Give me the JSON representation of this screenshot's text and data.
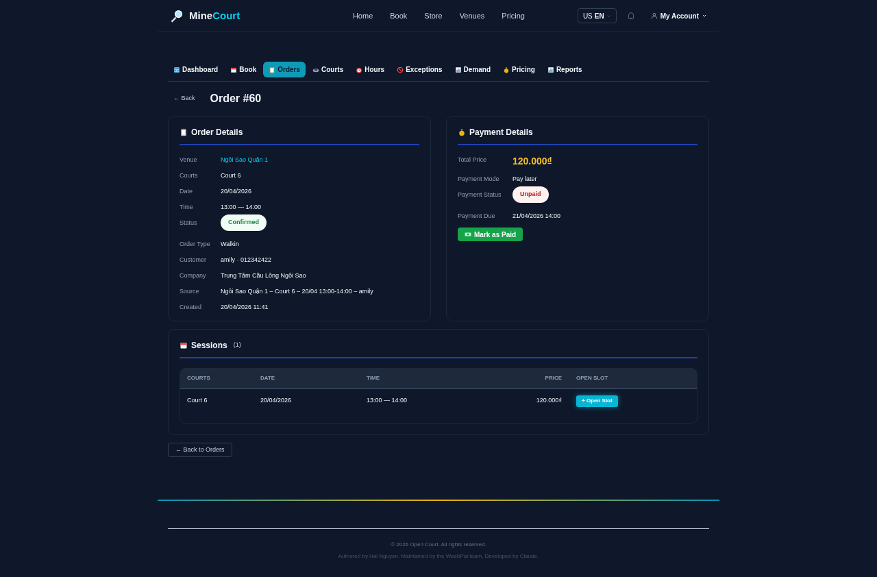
{
  "brand": {
    "first": "Mine",
    "second": "Court"
  },
  "nav": [
    "Home",
    "Book",
    "Store",
    "Venues",
    "Pricing"
  ],
  "language": {
    "flag": "US",
    "code": "EN"
  },
  "account": "My Account",
  "tabs": [
    {
      "label": "Dashboard",
      "selected": false
    },
    {
      "label": "Book",
      "selected": false
    },
    {
      "label": "Orders",
      "selected": true
    },
    {
      "label": "Courts",
      "selected": false
    },
    {
      "label": "Hours",
      "selected": false
    },
    {
      "label": "Exceptions",
      "selected": false
    },
    {
      "label": "Demand",
      "selected": false
    },
    {
      "label": "Pricing",
      "selected": false
    },
    {
      "label": "Reports",
      "selected": false
    }
  ],
  "back": "← Back",
  "page_title": "Order #60",
  "order_details": {
    "title": "Order Details",
    "rows": [
      {
        "label": "Venue",
        "value": "Ngôi Sao Quận 1",
        "kind": "link"
      },
      {
        "label": "Courts",
        "value": "Court 6",
        "kind": "text"
      },
      {
        "label": "Date",
        "value": "20/04/2026",
        "kind": "text"
      },
      {
        "label": "Time",
        "value": "13:00 — 14:00",
        "kind": "text"
      },
      {
        "label": "Status",
        "value": "Confirmed",
        "kind": "success"
      },
      {
        "label": "Order Type",
        "value": "Walkin",
        "kind": "text"
      },
      {
        "label": "Customer",
        "value": "amily · 012342422",
        "kind": "text"
      },
      {
        "label": "Company",
        "value": "Trung Tâm Cầu Lông Ngôi Sao",
        "kind": "text"
      },
      {
        "label": "Source",
        "value": "Ngôi Sao Quận 1 – Court 6 – 20/04 13:00-14:00 – amily",
        "kind": "text"
      },
      {
        "label": "Created",
        "value": "20/04/2026 11:41",
        "kind": "text"
      }
    ]
  },
  "payment_details": {
    "title": "Payment Details",
    "rows": [
      {
        "label": "Total Price",
        "value": "120.000₫",
        "kind": "price"
      },
      {
        "label": "Payment Mode",
        "value": "Pay later",
        "kind": "text"
      },
      {
        "label": "Payment Status",
        "value": "Unpaid",
        "kind": "danger"
      },
      {
        "label": "Payment Due",
        "value": "21/04/2026 14:00",
        "kind": "text"
      }
    ],
    "button": "Mark as Paid"
  },
  "sessions": {
    "title": "Sessions",
    "count": "(1)",
    "columns": [
      "COURTS",
      "DATE",
      "TIME",
      "PRICE",
      "OPEN SLOT"
    ],
    "rows": [
      {
        "court": "Court 6",
        "date": "20/04/2026",
        "time": "13:00 — 14:00",
        "price": "120.000₫",
        "action": "+ Open Slot"
      }
    ]
  },
  "back_to_orders": "← Back to Orders",
  "footer": {
    "copyright": "© 2026 Open Court. All rights reserved.",
    "credits": "Authored by Hai Nguyen, Maintained by the WeebPal team, Developed by Claude."
  }
}
